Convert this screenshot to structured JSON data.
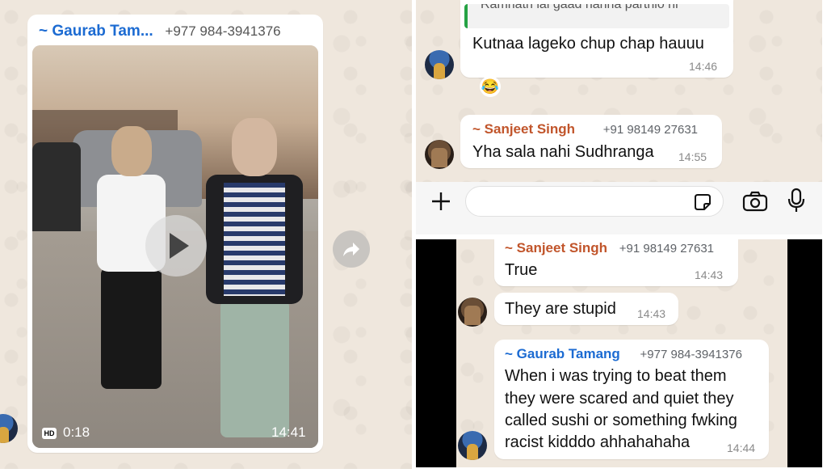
{
  "left_panel": {
    "video_message": {
      "sender_name": "~ Gaurab Tam...",
      "sender_phone": "+977 984-3941376",
      "hd_label": "HD",
      "duration": "0:18",
      "time": "14:41"
    }
  },
  "top_right_panel": {
    "reply_quote_text": "Ramnath lai gaad hanna parthio ni",
    "messages": [
      {
        "text": "Kutnaa lageko chup chap hauuu",
        "time": "14:46"
      },
      {
        "sender_name": "~ Sanjeet Singh",
        "sender_phone": "+91 98149 27631",
        "text": "Yha sala nahi Sudhranga",
        "time": "14:55"
      }
    ],
    "reaction": "😂",
    "input_bar": {
      "placeholder": ""
    }
  },
  "bottom_right_panel": {
    "messages": [
      {
        "sender_name": "~ Sanjeet Singh",
        "sender_phone": "+91 98149 27631",
        "text": "True",
        "time": "14:43"
      },
      {
        "text": "They are stupid",
        "time": "14:43"
      },
      {
        "sender_name": "~ Gaurab Tamang",
        "sender_phone": "+977 984-3941376",
        "lines": [
          "When i was trying to beat them",
          "they were scared and quiet they",
          "called sushi or something fwking",
          "racist kidddo ahhahahaha"
        ],
        "time": "14:44"
      }
    ]
  },
  "colors": {
    "gaurab_name": "#1c6bd2",
    "sanjeet_name": "#c1552b",
    "wallpaper": "#efe7dd",
    "bubble": "#ffffff"
  }
}
